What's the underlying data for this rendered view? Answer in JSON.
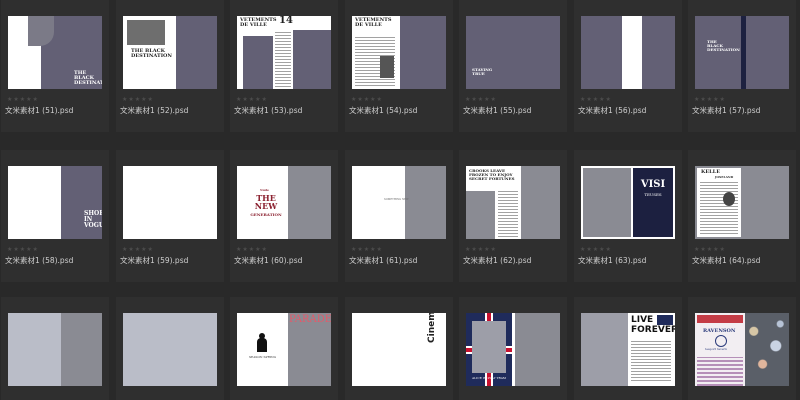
{
  "files": [
    {
      "name": "文米素材1 (51).psd",
      "stars": "★★★★★"
    },
    {
      "name": "文米素材1 (52).psd",
      "stars": "★★★★★"
    },
    {
      "name": "文米素材1 (53).psd",
      "stars": "★★★★★"
    },
    {
      "name": "文米素材1 (54).psd",
      "stars": "★★★★★"
    },
    {
      "name": "文米素材1 (55).psd",
      "stars": "★★★★★"
    },
    {
      "name": "文米素材1 (56).psd",
      "stars": "★★★★★"
    },
    {
      "name": "文米素材1 (57).psd",
      "stars": "★★★★★"
    },
    {
      "name": "文米素材1 (58).psd",
      "stars": "★★★★★"
    },
    {
      "name": "文米素材1 (59).psd",
      "stars": "★★★★★"
    },
    {
      "name": "文米素材1 (60).psd",
      "stars": "★★★★★"
    },
    {
      "name": "文米素材1 (61).psd",
      "stars": "★★★★★"
    },
    {
      "name": "文米素材1 (62).psd",
      "stars": "★★★★★"
    },
    {
      "name": "文米素材1 (63).psd",
      "stars": "★★★★★"
    },
    {
      "name": "文米素材1 (64).psd",
      "stars": "★★★★★"
    },
    {
      "name": "",
      "stars": ""
    },
    {
      "name": "",
      "stars": ""
    },
    {
      "name": "",
      "stars": ""
    },
    {
      "name": "",
      "stars": ""
    },
    {
      "name": "",
      "stars": ""
    },
    {
      "name": "",
      "stars": ""
    },
    {
      "name": "",
      "stars": ""
    }
  ],
  "thumb_text": {
    "t51": "THE BLACK DESTINATION",
    "t52": "THE BLACK DESTINATION",
    "t53a": "VETEMENTS DE VILLE",
    "t53b": "14",
    "t54": "VETEMENTS DE VILLE",
    "t55": "STAYING TRUE",
    "t57": "THE BLACK DESTINATION",
    "t58": "SHOES IN VOGUE",
    "t60a": "Nude",
    "t60b": "THE NEW",
    "t60c": "GENERATION",
    "t61": "SOMETHING NEW",
    "t62": "CROOKS LEAVE FROZEN TO ENJOY SECRET FORTUNES",
    "t63a": "VISI",
    "t63b": "TEUSES",
    "t64": "KELLE",
    "t64b": "JOSELAND",
    "t67a": "PARADE",
    "t67b": "SEASON SPRING",
    "t68": "Cinema",
    "t69": "ALICE IN PLAY TRAM",
    "t70a": "LIVE",
    "t70b": "FOREVER",
    "t71a": "RAVENSON",
    "t71b": "teaport tavern"
  }
}
